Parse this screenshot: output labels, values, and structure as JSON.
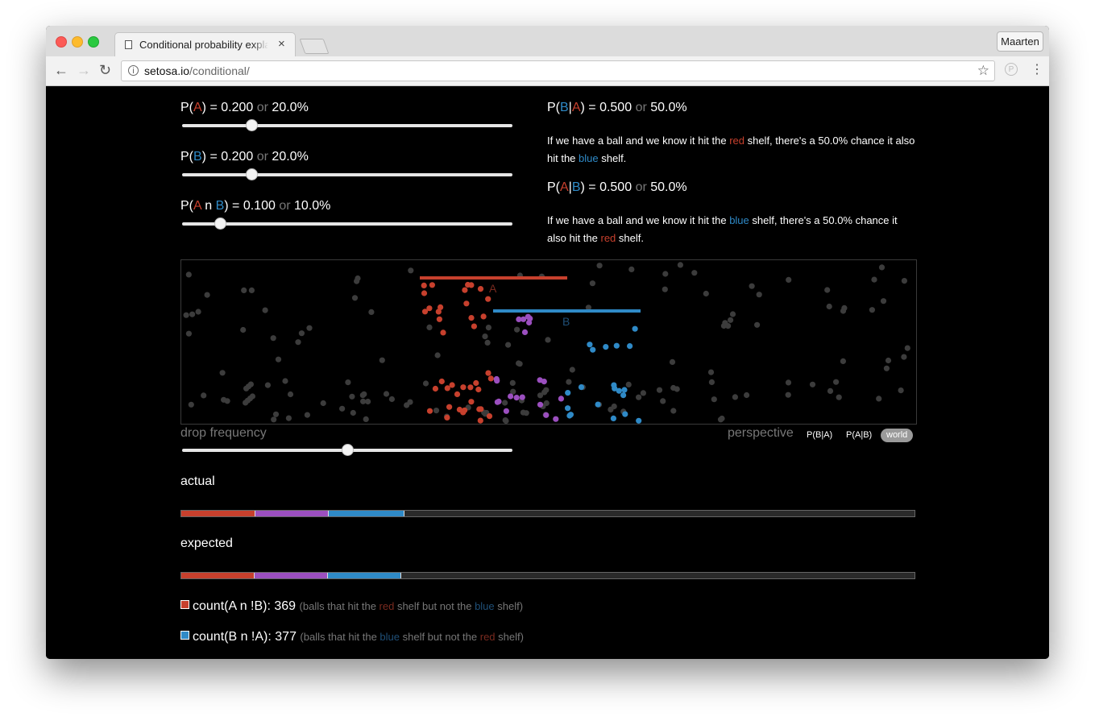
{
  "browser": {
    "tab_title": "Conditional probability explained visually",
    "tab_close": "×",
    "profile": "Maarten",
    "url_host": "setosa.io",
    "url_path": "/conditional/",
    "back_icon": "arrow-left-icon",
    "forward_icon": "arrow-right-icon",
    "reload_icon": "reload-icon",
    "star_icon": "star-icon",
    "menu_icon": "kebab-menu-icon"
  },
  "colors": {
    "red": "#c7402d",
    "blue": "#2f8ac7",
    "purple": "#9b4fbf",
    "grey_ball": "#3c3c3c",
    "track": "#2a2a2a"
  },
  "sliders": {
    "pa": {
      "prefix": "P(",
      "event": "A",
      "suffix": ") = 0.200",
      "or": "or",
      "percent": "20.0%",
      "value": 0.2
    },
    "pb": {
      "prefix": "P(",
      "event": "B",
      "suffix": ") = 0.200",
      "or": "or",
      "percent": "20.0%",
      "value": 0.2
    },
    "pab": {
      "prefix": "P(",
      "event_a": "A",
      "n": " n ",
      "event_b": "B",
      "suffix": ") = 0.100",
      "or": "or",
      "percent": "10.0%",
      "value": 0.1
    }
  },
  "conditional": {
    "pba": {
      "prefix": "P(",
      "first": "B",
      "bar": "|",
      "second": "A",
      "suffix": ") = 0.500",
      "or": "or",
      "percent": "50.0%",
      "text1": "If we have a ball and we know it hit the ",
      "color1": "red",
      "text2": " shelf, there's a 50.0% chance it also hit the ",
      "color2": "blue",
      "text3": " shelf."
    },
    "pab": {
      "prefix": "P(",
      "first": "A",
      "bar": "|",
      "second": "B",
      "suffix": ") = 0.500",
      "or": "or",
      "percent": "50.0%",
      "text1": "If we have a ball and we know it hit the ",
      "color1": "blue",
      "text2": " shelf, there's a 50.0% chance it also hit the ",
      "color2": "red",
      "text3": " shelf."
    }
  },
  "simulation": {
    "shelf_a_label": "A",
    "shelf_b_label": "B",
    "drop_frequency_label": "drop frequency",
    "drop_frequency_value": 0.5,
    "perspective_label": "perspective",
    "perspectives": [
      "P(B|A)",
      "P(A|B)",
      "world"
    ],
    "active_perspective": "world"
  },
  "actual": {
    "label": "actual",
    "segments": [
      0.101,
      0.1,
      0.103,
      0.696
    ]
  },
  "expected": {
    "label": "expected",
    "segments": [
      0.1,
      0.1,
      0.1,
      0.7
    ]
  },
  "counts": [
    {
      "label": "count(A n !B): 369",
      "d1": "(balls that hit the ",
      "c1": "red",
      "d2": " shelf but not the ",
      "c2": "blue",
      "d3": " shelf)",
      "color": "red"
    },
    {
      "label": "count(B n !A): 377",
      "d1": "(balls that hit the ",
      "c1": "blue",
      "d2": " shelf but not the ",
      "c2": "red",
      "d3": " shelf)",
      "color": "blue"
    }
  ]
}
